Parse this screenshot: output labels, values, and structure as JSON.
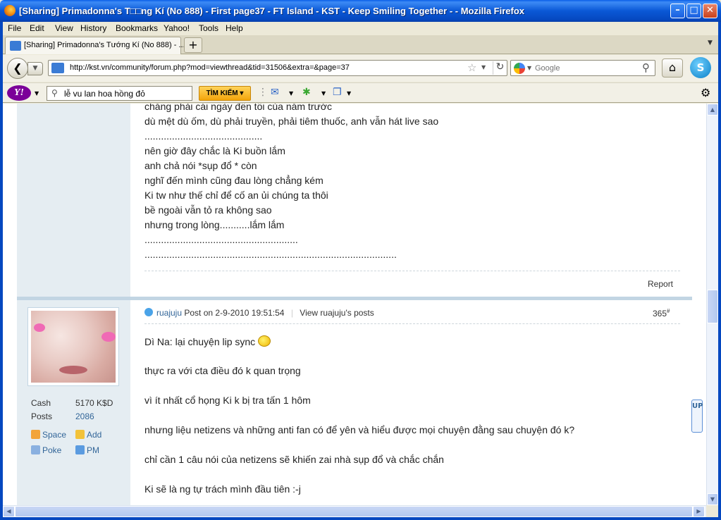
{
  "window": {
    "title": "[Sharing] Primadonna's T□□ng Kí (No 888) - First page37 - FT Island - KST - Keep Smiling Together - - Mozilla Firefox"
  },
  "menu": [
    "File",
    "Edit",
    "View",
    "History",
    "Bookmarks",
    "Yahoo!",
    "Tools",
    "Help"
  ],
  "tabs": [
    {
      "label": "[Sharing] Primadonna's Tướng Kí (No 888) - ..."
    }
  ],
  "nav": {
    "url": "http://kst.vn/community/forum.php?mod=viewthread&tid=31506&extra=&page=37",
    "search_placeholder": "Google"
  },
  "yahoo": {
    "search_text": "lễ vu lan hoa hồng đỏ",
    "search_button": "TÌM KIẾM"
  },
  "prev_post": {
    "lines": [
      "chẳng phải cái ngày đến tối của năm trước",
      "dù mệt dù ốm, dù phải truyền, phải tiêm thuốc, anh vẫn hát live sao",
      "...........................................",
      "nên giờ đây chắc là Ki buồn lắm",
      "anh chả nói *sụp đổ * còn",
      "nghĩ đến mình cũng đau lòng chẳng kém",
      "Ki tw như thế chỉ để cố an ủi chúng ta thôi",
      "bề ngoài vẫn tỏ ra không sao",
      "nhưng trong lòng...........lắm lắm",
      "........................................................",
      "............................................................................................"
    ],
    "report": "Report"
  },
  "post": {
    "author": "ruajuju",
    "posted": "Post on 2-9-2010 19:51:54",
    "view_posts": "View ruajuju's posts",
    "number": "365",
    "number_sup": "#",
    "lines": [
      "Dì Na: lại chuyện lip sync",
      "thực ra với cta điều đó k quan trọng",
      "vì ít nhất cổ họng Ki k bị tra tấn 1 hôm",
      "nhưng liệu netizens và những anti fan có để yên và hiểu được mọi chuyện đằng sau chuyện đó k?",
      "chỉ cần 1 câu nói của netizens sẽ khiến zai nhà sụp đổ và chắc chắn",
      "Ki sẽ là ng tự trách mình đầu tiên :-j"
    ]
  },
  "profile": {
    "cash_label": "Cash",
    "cash_value": "5170 K$D",
    "posts_label": "Posts",
    "posts_value": "2086",
    "space": "Space",
    "add": "Add",
    "poke": "Poke",
    "pm": "PM"
  },
  "up_tab": "UP"
}
